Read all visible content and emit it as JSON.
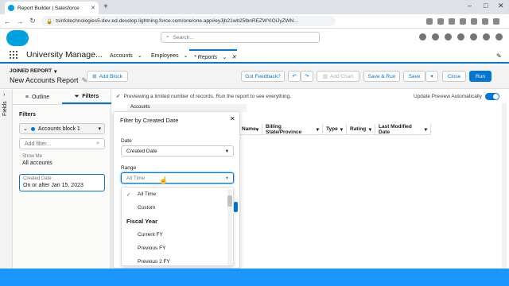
{
  "browser": {
    "tab_title": "Report Builder | Salesforce",
    "url": "tsinfotechnologies5-dev-ed.develop.lightning.force.com/one/one.app#eyJjb21wb25lbnREZWYiOiJyZWN..."
  },
  "header": {
    "search_placeholder": "Search..."
  },
  "appnav": {
    "app_name": "University Manage...",
    "items": [
      "Accounts",
      "Employees"
    ],
    "active_tab": "* Reports"
  },
  "builder": {
    "report_type": "JOINED REPORT",
    "report_name": "New Accounts Report",
    "add_block": "Add Block",
    "feedback": "Got Feedback?",
    "add_chart": "Add Chart",
    "save_run": "Save & Run",
    "save": "Save",
    "close": "Close",
    "run": "Run"
  },
  "left": {
    "rail_label": "Fields",
    "tab_outline": "Outline",
    "tab_filters": "Filters",
    "filters_heading": "Filters",
    "block_name": "Accounts block 1",
    "add_filter_placeholder": "Add filter...",
    "show_me_label": "Show Me",
    "show_me_value": "All accounts",
    "created_label": "Created Date",
    "created_value": "On or after Jan 15, 2023"
  },
  "infobar": {
    "message": "Previewing a limited number of records. Run the report to see everything.",
    "toggle_label": "Update Preview Automatically"
  },
  "table": {
    "block_label": "Accounts",
    "columns": [
      "Name",
      "Billing State/Province",
      "Type",
      "Rating",
      "Last Modified Date"
    ]
  },
  "popover": {
    "title": "Filter by Created Date",
    "date_label": "Date",
    "date_value": "Created Date",
    "range_label": "Range",
    "range_value": "All Time",
    "options": [
      {
        "label": "All Time",
        "checked": true
      },
      {
        "label": "Custom"
      },
      {
        "label": "Fiscal Year",
        "group": true
      },
      {
        "label": "Current FY"
      },
      {
        "label": "Previous FY"
      },
      {
        "label": "Previous 2 FY"
      }
    ]
  },
  "colors": {
    "brand": "#0176d3",
    "cloud": "#00a1e0",
    "bottom": "#1b96ff"
  }
}
